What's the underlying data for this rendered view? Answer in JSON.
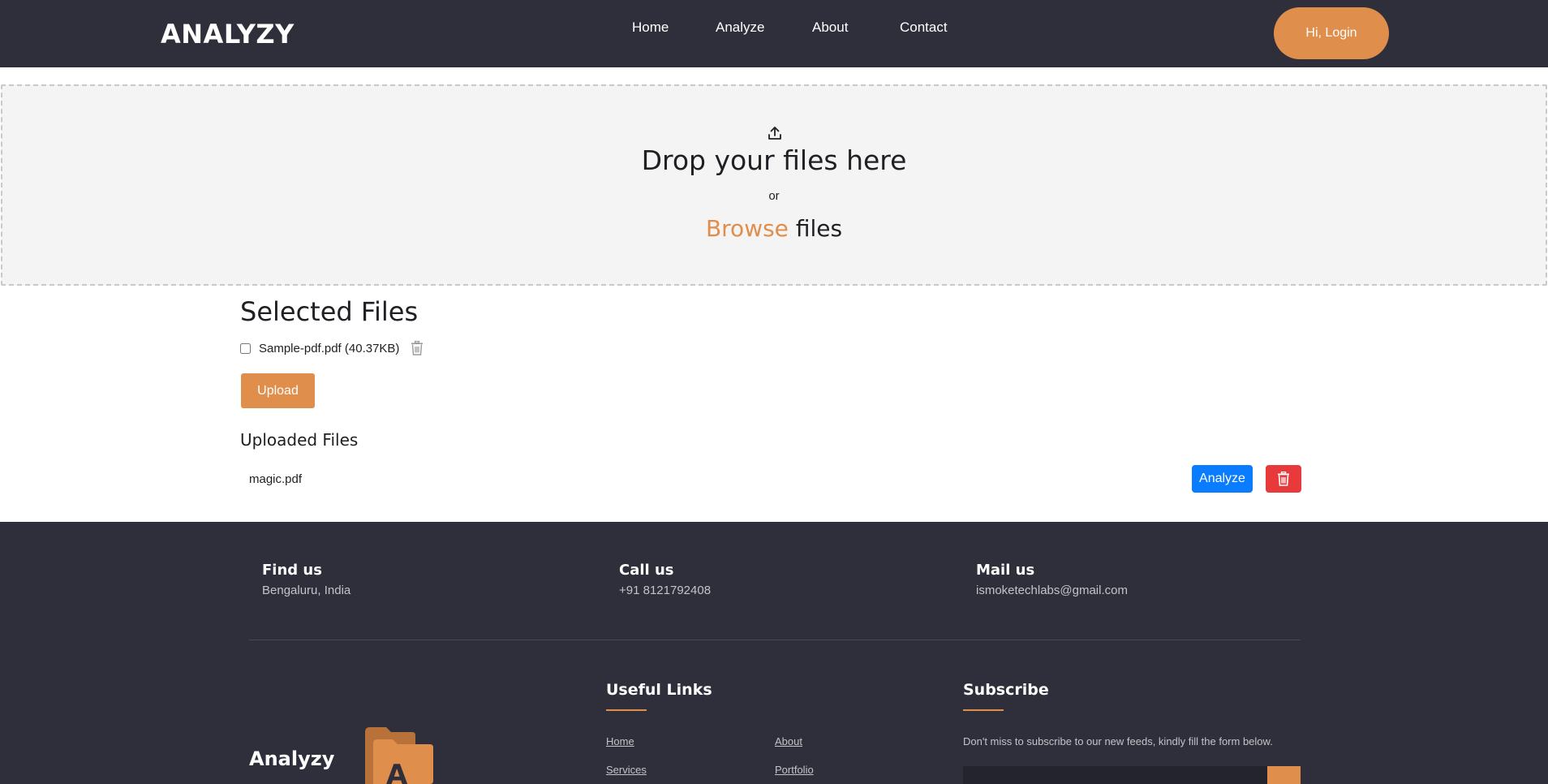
{
  "nav": {
    "brand": "ANALYZY",
    "links": [
      "Home",
      "Analyze",
      "About",
      "Contact"
    ],
    "login_label": "Hi, Login"
  },
  "dropzone": {
    "title": "Drop your files here",
    "or": "or",
    "browse": "Browse",
    "files": "files"
  },
  "selected": {
    "title": "Selected Files",
    "files": [
      {
        "name": "Sample-pdf.pdf (40.37KB)",
        "checked": false
      }
    ],
    "upload_label": "Upload"
  },
  "uploaded": {
    "title": "Uploaded Files",
    "files": [
      {
        "name": "magic.pdf",
        "analyze_label": "Analyze"
      }
    ]
  },
  "footer": {
    "contacts": [
      {
        "title": "Find us",
        "value": "Bengaluru, India"
      },
      {
        "title": "Call us",
        "value": "+91 8121792408"
      },
      {
        "title": "Mail us",
        "value": "ismoketechlabs@gmail.com"
      }
    ],
    "brand": "Analyzy",
    "useful_links": {
      "title": "Useful Links",
      "links": [
        "Home",
        "About",
        "Services",
        "Portfolio"
      ]
    },
    "subscribe": {
      "title": "Subscribe",
      "text": "Don't miss to subscribe to our new feeds, kindly fill the form below."
    }
  },
  "colors": {
    "navbar_bg": "#2f2f3b",
    "accent": "#e08e4b",
    "analyze_blue": "#0a7cff",
    "delete_red": "#e83a3a"
  },
  "icons": {
    "upload": "upload-icon",
    "trash": "trash-icon",
    "logo": "folder-logo-icon"
  }
}
